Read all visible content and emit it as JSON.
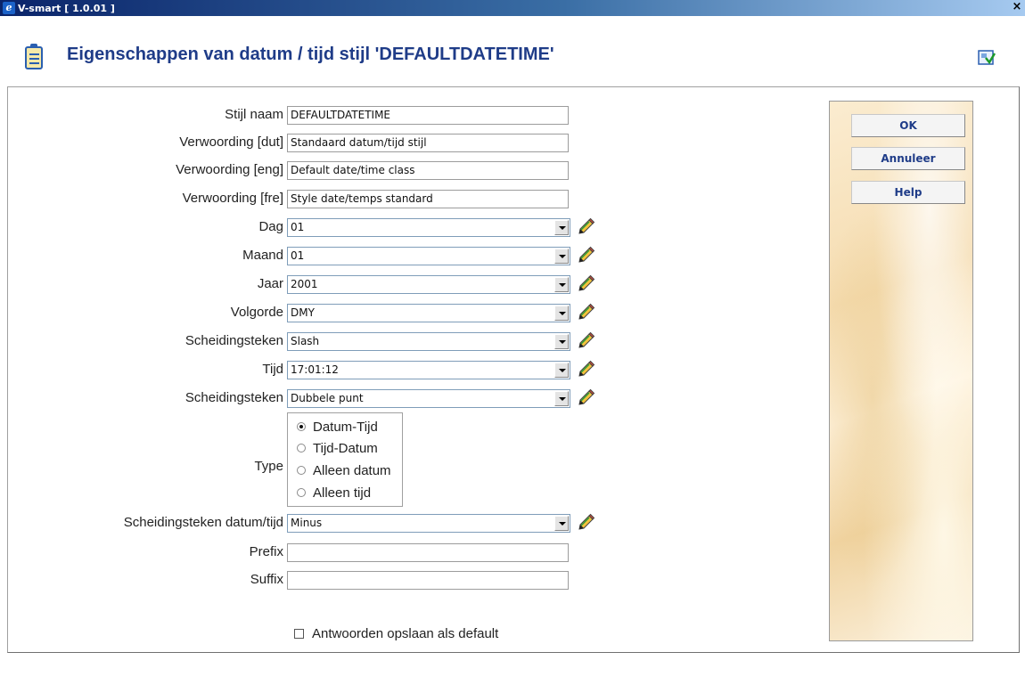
{
  "window": {
    "title": "V-smart [ 1.0.01 ]",
    "close_glyph": "×"
  },
  "header": {
    "title": "Eigenschappen van datum / tijd stijl 'DEFAULTDATETIME'",
    "icon": "clipboard-icon",
    "help_icon": "help-icon"
  },
  "form": {
    "stijl_naam": {
      "label": "Stijl naam",
      "value": "DEFAULTDATETIME"
    },
    "verwoording_dut": {
      "label": "Verwoording [dut]",
      "value": "Standaard datum/tijd stijl"
    },
    "verwoording_eng": {
      "label": "Verwoording [eng]",
      "value": "Default date/time class"
    },
    "verwoording_fre": {
      "label": "Verwoording [fre]",
      "value": "Style date/temps standard"
    },
    "dag": {
      "label": "Dag",
      "value": "01"
    },
    "maand": {
      "label": "Maand",
      "value": "01"
    },
    "jaar": {
      "label": "Jaar",
      "value": "2001"
    },
    "volgorde": {
      "label": "Volgorde",
      "value": "DMY"
    },
    "scheidingsteken_datum": {
      "label": "Scheidingsteken",
      "value": "Slash"
    },
    "tijd": {
      "label": "Tijd",
      "value": "17:01:12"
    },
    "scheidingsteken_tijd": {
      "label": "Scheidingsteken",
      "value": "Dubbele punt"
    },
    "type": {
      "label": "Type",
      "options": [
        "Datum-Tijd",
        "Tijd-Datum",
        "Alleen datum",
        "Alleen tijd"
      ],
      "selected": "Datum-Tijd"
    },
    "scheidingsteken_datum_tijd": {
      "label": "Scheidingsteken datum/tijd",
      "value": "Minus"
    },
    "prefix": {
      "label": "Prefix",
      "value": ""
    },
    "suffix": {
      "label": "Suffix",
      "value": ""
    },
    "save_default": {
      "label": "Antwoorden opslaan als default",
      "checked": false
    }
  },
  "buttons": {
    "ok": "OK",
    "annuleer": "Annuleer",
    "help": "Help"
  },
  "colors": {
    "title_text": "#1f3c88",
    "titlebar_start": "#0a246a",
    "button_text": "#1f3c88"
  }
}
